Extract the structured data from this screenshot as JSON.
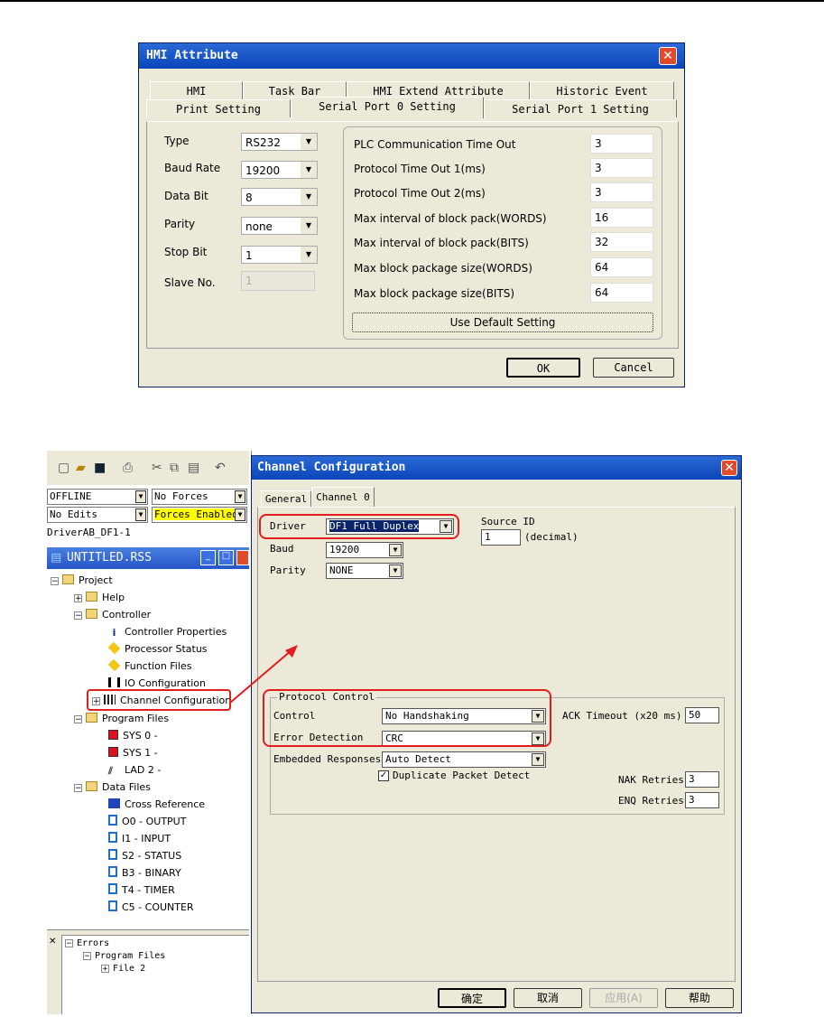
{
  "hmi_dialog": {
    "title": "HMI Attribute",
    "tabs_row1": [
      "HMI",
      "Task Bar",
      "HMI Extend Attribute",
      "Historic Event"
    ],
    "tabs_row2": [
      "Print Setting",
      "Serial Port 0 Setting",
      "Serial Port 1 Setting"
    ],
    "fields": [
      {
        "label": "Type",
        "value": "RS232"
      },
      {
        "label": "Baud Rate",
        "value": "19200"
      },
      {
        "label": "Data Bit",
        "value": "8"
      },
      {
        "label": "Parity",
        "value": "none"
      },
      {
        "label": "Stop Bit",
        "value": "1"
      },
      {
        "label": "Slave No.",
        "value": "1"
      }
    ],
    "params": [
      {
        "label": "PLC Communication Time Out",
        "value": "3"
      },
      {
        "label": "Protocol Time Out 1(ms)",
        "value": "3"
      },
      {
        "label": "Protocol Time Out 2(ms)",
        "value": "3"
      },
      {
        "label": "Max interval of block pack(WORDS)",
        "value": "16"
      },
      {
        "label": "Max interval of block pack(BITS)",
        "value": "32"
      },
      {
        "label": "Max block package size(WORDS)",
        "value": "64"
      },
      {
        "label": "Max block package size(BITS)",
        "value": "64"
      }
    ],
    "use_default": "Use Default Setting",
    "ok": "OK",
    "cancel": "Cancel"
  },
  "rslogix": {
    "mode": "OFFLINE",
    "forces": "No Forces",
    "edits": "No Edits",
    "forces_enabled": "Forces Enabled",
    "driver": "DriverAB_DF1-1",
    "project_window": "UNTITLED.RSS",
    "tree": [
      "Project",
      "Help",
      "Controller",
      "Controller Properties",
      "Processor Status",
      "Function Files",
      "IO Configuration",
      "Channel Configuration",
      "Program Files",
      "SYS 0 -",
      "SYS 1 -",
      "LAD 2 -",
      "Data Files",
      "Cross Reference",
      "O0 - OUTPUT",
      "I1 - INPUT",
      "S2 - STATUS",
      "B3 - BINARY",
      "T4 - TIMER",
      "C5 - COUNTER"
    ],
    "errors": [
      "Errors",
      "Program Files",
      "File 2"
    ]
  },
  "channel_dialog": {
    "title": "Channel Configuration",
    "tabs": [
      "General",
      "Channel 0"
    ],
    "driver_label": "Driver",
    "driver_value": "DF1 Full Duplex",
    "source_id_label": "Source ID",
    "source_id_value": "1",
    "source_id_unit": "(decimal)",
    "baud_label": "Baud",
    "baud_value": "19200",
    "parity_label": "Parity",
    "parity_value": "NONE",
    "protocol_group": "Protocol Control",
    "control_label": "Control",
    "control_value": "No Handshaking",
    "error_label": "Error Detection",
    "error_value": "CRC",
    "embedded_label": "Embedded Responses",
    "embedded_value": "Auto Detect",
    "dup_label": "Duplicate Packet Detect",
    "ack_label": "ACK Timeout (x20 ms)",
    "ack_value": "50",
    "nak_label": "NAK Retries",
    "nak_value": "3",
    "enq_label": "ENQ Retries",
    "enq_value": "3",
    "btn_ok": "确定",
    "btn_cancel": "取消",
    "btn_apply": "应用(A)",
    "btn_help": "帮助"
  }
}
